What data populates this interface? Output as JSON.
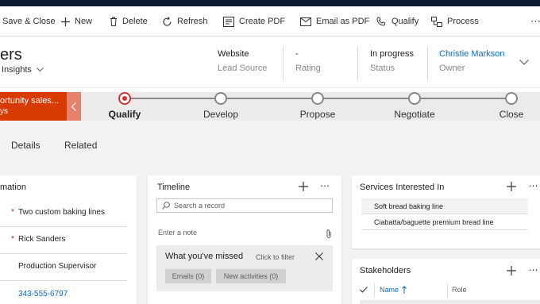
{
  "commands": {
    "save_close": "Save & Close",
    "new": "New",
    "delete": "Delete",
    "refresh": "Refresh",
    "create_pdf": "Create PDF",
    "email_pdf": "Email as PDF",
    "qualify": "Qualify",
    "process": "Process",
    "more": "⋯"
  },
  "header": {
    "title": "ers",
    "form_selector": "Insights",
    "fields": [
      {
        "value": "Website",
        "label": "Lead Source"
      },
      {
        "value": "-",
        "label": "Rating"
      },
      {
        "value": "In progress",
        "label": "Status"
      },
      {
        "value": "Christie Markson",
        "label": "Owner"
      }
    ]
  },
  "process": {
    "active_name": "ortunity sales...",
    "active_duration": "ys",
    "stages": [
      "Qualify",
      "Develop",
      "Propose",
      "Negotiate",
      "Close"
    ],
    "current_stage": "Qualify"
  },
  "tabs": [
    "Details",
    "Related"
  ],
  "summary": {
    "title": "mation",
    "rows": [
      {
        "required": "*",
        "value": "Two custom baking lines"
      },
      {
        "required": "*",
        "value": "Rick Sanders"
      },
      {
        "required": "",
        "value": "Production Supervisor"
      },
      {
        "required": "",
        "value": "343-555-6797"
      }
    ]
  },
  "timeline": {
    "title": "Timeline",
    "search_placeholder": "Search a record",
    "note_placeholder": "Enter a note",
    "missed_title": "What you've missed",
    "click_to_filter": "Click to filter",
    "emails": "Emails (0)",
    "new_activities": "New activities (0)"
  },
  "services": {
    "title": "Services Interested In",
    "items": [
      "Soft bread baking line",
      "Ciabatta/baguette premium bread line"
    ]
  },
  "stakeholders": {
    "title": "Stakeholders",
    "col_name": "Name",
    "col_role": "Role"
  },
  "colors": {
    "active_stage": "#d83b01",
    "link": "#0f6cbd",
    "current_stage_ring": "#d13438"
  }
}
